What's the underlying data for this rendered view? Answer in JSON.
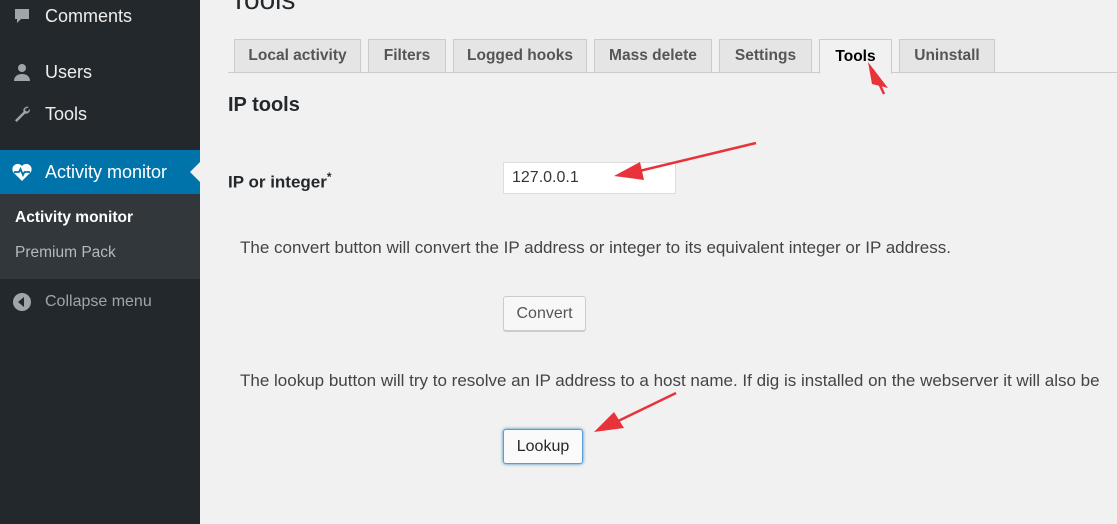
{
  "sidebar": {
    "items": [
      {
        "label": "Comments",
        "icon": "comment-icon"
      },
      {
        "label": "Users",
        "icon": "user-icon"
      },
      {
        "label": "Tools",
        "icon": "wrench-icon"
      },
      {
        "label": "Activity monitor",
        "icon": "heartbeat-icon"
      }
    ],
    "submenu": [
      {
        "label": "Activity monitor"
      },
      {
        "label": "Premium Pack"
      }
    ],
    "collapse_label": "Collapse menu"
  },
  "page": {
    "title": "Tools"
  },
  "tabs": [
    {
      "label": "Local activity"
    },
    {
      "label": "Filters"
    },
    {
      "label": "Logged hooks"
    },
    {
      "label": "Mass delete"
    },
    {
      "label": "Settings"
    },
    {
      "label": "Tools"
    },
    {
      "label": "Uninstall"
    }
  ],
  "ip_tools": {
    "title": "IP tools",
    "field_label": "IP or integer",
    "required_mark": "*",
    "input_value": "127.0.0.1",
    "convert_desc": "The convert button will convert the IP address or integer to its equivalent integer or IP address.",
    "convert_label": "Convert",
    "lookup_desc": "The lookup button will try to resolve an IP address to a host name. If dig is installed on the webserver it will also be",
    "lookup_label": "Lookup"
  },
  "colors": {
    "sidebar_bg": "#23282d",
    "active_menu_bg": "#0073aa",
    "annotation_arrow": "#e8333a"
  }
}
